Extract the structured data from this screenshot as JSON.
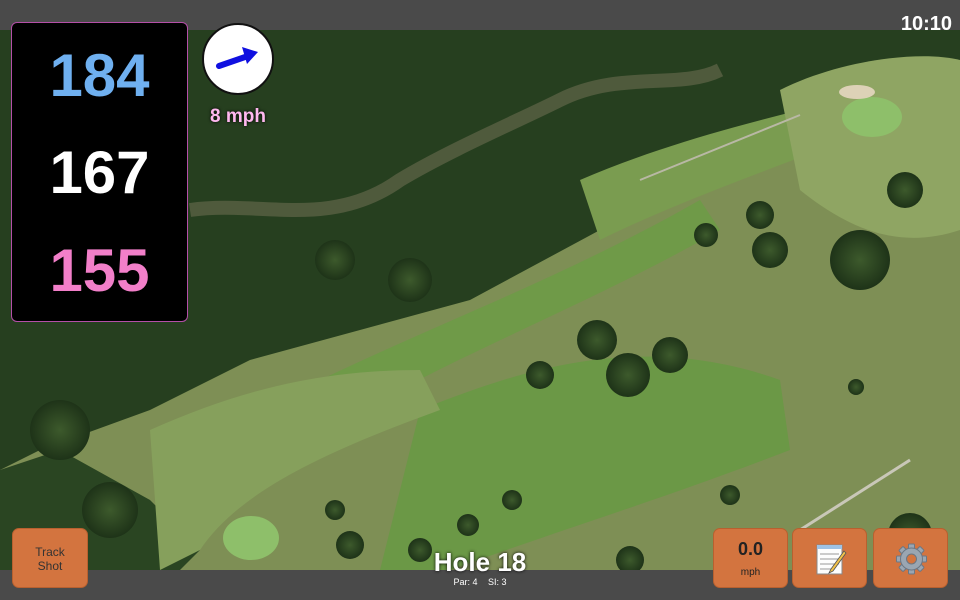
{
  "status": {
    "time": "10:10"
  },
  "distances": {
    "back": "184",
    "center": "167",
    "front": "155"
  },
  "wind": {
    "speed_label": "8 mph",
    "arrow_icon": "wind-direction-arrow-icon",
    "arrow_color": "#1010e0"
  },
  "buttons": {
    "track_shot_label": "Track Shot",
    "wind_value": "0.0",
    "wind_unit": "mph",
    "notes_icon": "notepad-icon",
    "settings_icon": "gear-icon"
  },
  "hole": {
    "title": "Hole 18",
    "par": "Par: 4",
    "si": "SI: 3"
  },
  "colors": {
    "back": "#6fb0f0",
    "center": "#ffffff",
    "front": "#f27fc9",
    "button": "#d3743f",
    "bar": "#4a4a4a"
  }
}
